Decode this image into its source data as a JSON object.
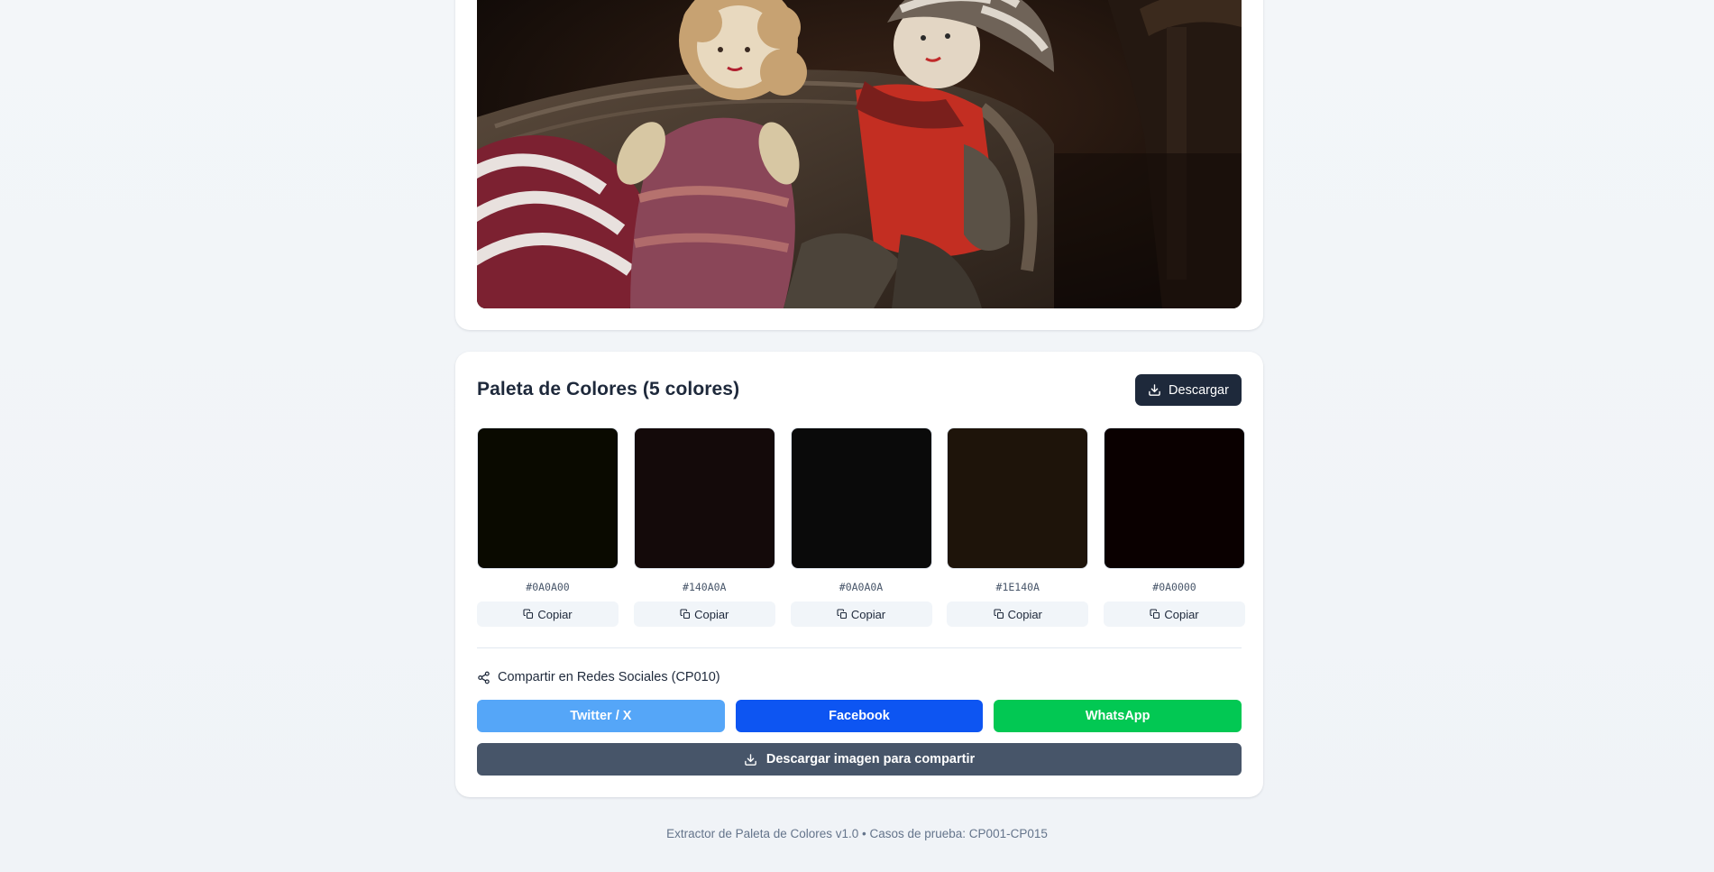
{
  "palette": {
    "title": "Paleta de Colores (5 colores)",
    "download_label": "Descargar",
    "colors": [
      {
        "hex": "#0A0A00",
        "copy_label": "Copiar"
      },
      {
        "hex": "#140A0A",
        "copy_label": "Copiar"
      },
      {
        "hex": "#0A0A0A",
        "copy_label": "Copiar"
      },
      {
        "hex": "#1E140A",
        "copy_label": "Copiar"
      },
      {
        "hex": "#0A0000",
        "copy_label": "Copiar"
      }
    ]
  },
  "share": {
    "heading": "Compartir en Redes Sociales (CP010)",
    "buttons": [
      {
        "label": "Twitter / X",
        "color": "#55a6f8"
      },
      {
        "label": "Facebook",
        "color": "#0d55f2"
      },
      {
        "label": "WhatsApp",
        "color": "#02c853"
      }
    ],
    "download_image_label": "Descargar imagen para compartir"
  },
  "footer": {
    "text": "Extractor de Paleta de Colores v1.0 • Casos de prueba: CP001-CP015"
  },
  "icons": {
    "download": "download-icon",
    "copy": "copy-icon",
    "share": "share-icon"
  }
}
